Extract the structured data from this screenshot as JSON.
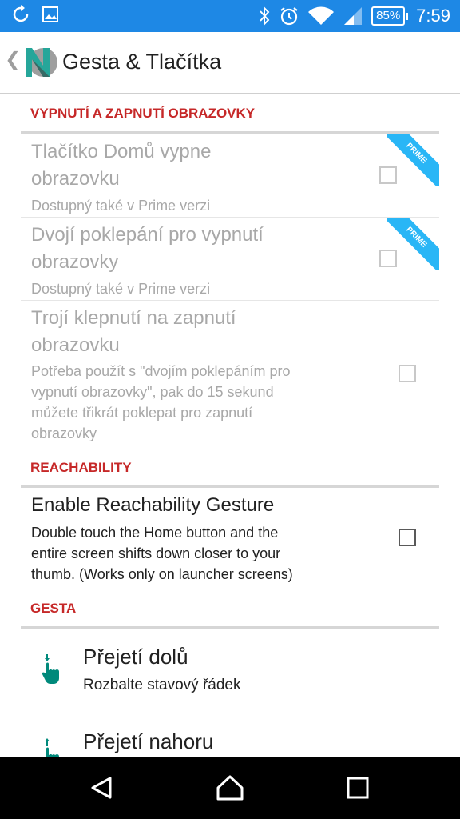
{
  "status_bar": {
    "left_icons": [
      "sync-icon",
      "image-icon"
    ],
    "right_icons": [
      "bluetooth-icon",
      "alarm-icon",
      "wifi-icon",
      "signal-icon"
    ],
    "battery": "85",
    "battery_suffix": "%",
    "time": "7:59"
  },
  "action_bar": {
    "back_icon": "chevron-left-icon",
    "logo_icon": "nova-logo-icon",
    "title": "Gesta & Tlačítka"
  },
  "sections": {
    "screen": {
      "header": "VYPNUTÍ A ZAPNUTÍ OBRAZOVKY",
      "items": [
        {
          "title_line1": "Tlačítko Domů vypne",
          "title_line2": "obrazovku",
          "summary_line1": "Dostupný také v Prime verzi",
          "checked": false,
          "badge": "PRIME"
        },
        {
          "title_line1": "Dvojí poklepání pro vypnutí",
          "title_line2": "obrazovky",
          "summary_line1": "Dostupný také v Prime verzi",
          "checked": false,
          "badge": "PRIME"
        },
        {
          "title_line1": "Trojí klepnutí na zapnutí",
          "title_line2": "obrazovku",
          "summary_line1": "Potřeba použít s \"dvojím poklepáním pro",
          "summary_line2": "vypnutí obrazovky\", pak do 15 sekund",
          "summary_line3": "můžete třikrát poklepat pro zapnutí",
          "summary_line4": "obrazovky",
          "checked": false
        }
      ]
    },
    "reachability": {
      "header": "REACHABILITY",
      "item": {
        "title": "Enable Reachability Gesture",
        "summary_line1": "Double touch the Home button and the",
        "summary_line2": "entire screen shifts down closer to your",
        "summary_line3": "thumb. (Works only on launcher screens)",
        "checked": false
      }
    },
    "gesta": {
      "header": "GESTA",
      "items": [
        {
          "icon": "swipe-down-hand-icon",
          "title": "Přejetí dolů",
          "subtitle": "Rozbalte stavový řádek"
        },
        {
          "icon": "swipe-up-hand-icon",
          "title": "Přejetí nahoru",
          "subtitle": ""
        }
      ]
    }
  },
  "colors": {
    "status_bar": "#1e88e5",
    "section_header": "#c62828",
    "prime_badge": "#29b6f6",
    "gesture_icon": "#00897b"
  },
  "nav_bar": {
    "back": "back-triangle-icon",
    "home": "home-circle-icon",
    "recents": "recents-square-icon"
  }
}
